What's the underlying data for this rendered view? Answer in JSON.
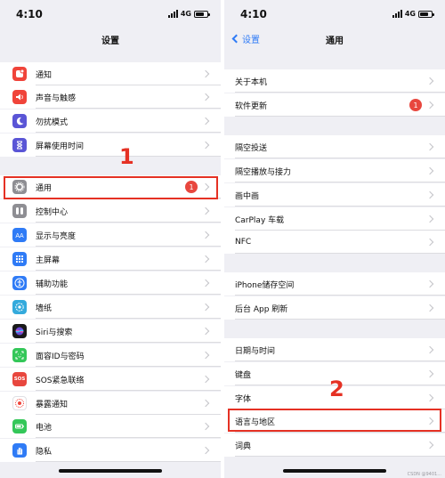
{
  "left": {
    "status": {
      "time": "4:10",
      "network": "4G"
    },
    "title": "设置",
    "annotation": "1",
    "rows": [
      {
        "label": "通知",
        "icon": "notification-icon",
        "color": "#f0443a"
      },
      {
        "label": "声音与触感",
        "icon": "sound-icon",
        "color": "#f0443a"
      },
      {
        "label": "勿扰模式",
        "icon": "moon-icon",
        "color": "#5a55d6"
      },
      {
        "label": "屏幕使用时间",
        "icon": "hourglass-icon",
        "color": "#5a55d6"
      },
      {
        "label": "通用",
        "icon": "gear-icon",
        "color": "#8e8e93",
        "badge": "1"
      },
      {
        "label": "控制中心",
        "icon": "control-center-icon",
        "color": "#8e8e93"
      },
      {
        "label": "显示与亮度",
        "icon": "display-icon",
        "color": "#2f7bf6"
      },
      {
        "label": "主屏幕",
        "icon": "home-screen-icon",
        "color": "#2f7bf6"
      },
      {
        "label": "辅助功能",
        "icon": "accessibility-icon",
        "color": "#2f7bf6"
      },
      {
        "label": "墙纸",
        "icon": "wallpaper-icon",
        "color": "#34aadc"
      },
      {
        "label": "Siri与搜索",
        "icon": "siri-icon",
        "color": "#1a1a1a"
      },
      {
        "label": "面容ID与密码",
        "icon": "face-id-icon",
        "color": "#34c759"
      },
      {
        "label": "SOS紧急联络",
        "icon": "sos-icon",
        "color": "#e8473e",
        "icon_text": "SOS"
      },
      {
        "label": "暴露通知",
        "icon": "exposure-icon",
        "color": "#ffffff"
      },
      {
        "label": "电池",
        "icon": "battery-setting-icon",
        "color": "#34c759"
      },
      {
        "label": "隐私",
        "icon": "privacy-hand-icon",
        "color": "#2f7bf6"
      }
    ]
  },
  "right": {
    "status": {
      "time": "4:10",
      "network": "4G"
    },
    "back_label": "设置",
    "title": "通用",
    "annotation": "2",
    "rows": [
      {
        "label": "关于本机"
      },
      {
        "label": "软件更新",
        "badge": "1"
      },
      {
        "label": "隔空投送"
      },
      {
        "label": "隔空播放与接力"
      },
      {
        "label": "画中画"
      },
      {
        "label": "CarPlay 车载"
      },
      {
        "label": "NFC"
      },
      {
        "label": "iPhone储存空间"
      },
      {
        "label": "后台 App 刷新"
      },
      {
        "label": "日期与时间"
      },
      {
        "label": "键盘"
      },
      {
        "label": "字体"
      },
      {
        "label": "语言与地区"
      },
      {
        "label": "词典"
      }
    ]
  },
  "watermark": "CSDN @9401..."
}
